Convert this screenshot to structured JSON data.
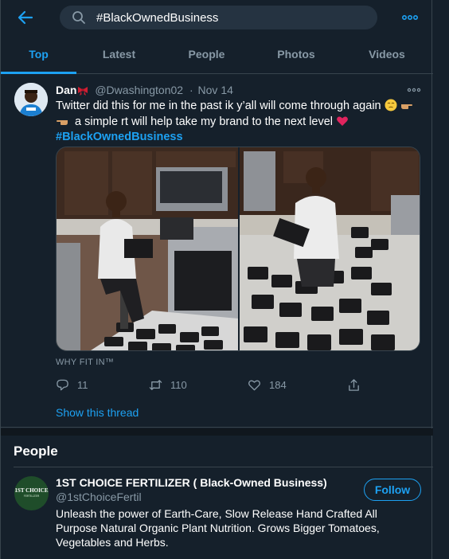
{
  "search": {
    "query": "#BlackOwnedBusiness"
  },
  "tabs": [
    {
      "label": "Top"
    },
    {
      "label": "Latest"
    },
    {
      "label": "People"
    },
    {
      "label": "Photos"
    },
    {
      "label": "Videos"
    }
  ],
  "tweet": {
    "name": "Dan",
    "handle": "@Dwashington02",
    "sep": "·",
    "date": "Nov 14",
    "text_line1": "Twitter did this for me in the past ik y’all will come through again",
    "text_line2": "a simple rt will help take my brand to the next level",
    "hashtag": "#BlackOwnedBusiness",
    "media_caption": "WHY FIT IN™",
    "replies": "11",
    "retweets": "110",
    "likes": "184",
    "show_thread": "Show this thread"
  },
  "people": {
    "title": "People",
    "items": [
      {
        "name": "1ST CHOICE FERTILIZER ( Black-Owned Business)",
        "handle": "@1stChoiceFertil",
        "bio": "Unleash the power of Earth-Care, Slow Release Hand Crafted All Purpose Natural Organic Plant Nutrition. Grows Bigger Tomatoes, Vegetables and Herbs.",
        "follow_label": "Follow",
        "logo_text": "1ST CHOICE",
        "logo_sub": "FERTILIZER"
      }
    ]
  },
  "colors": {
    "background": "#15202b",
    "accent": "#1da1f2",
    "secondary_text": "#8899a6",
    "border": "#38444d"
  }
}
